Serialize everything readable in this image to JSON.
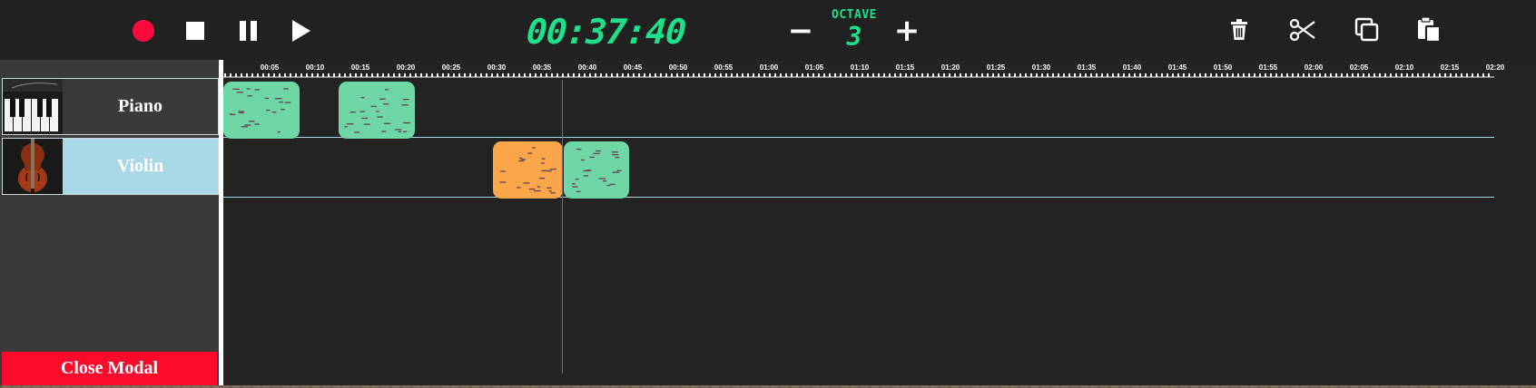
{
  "toolbar": {
    "record_icon": "record-icon",
    "stop_icon": "stop-icon",
    "pause_icon": "pause-icon",
    "play_icon": "play-icon",
    "time": "00:37:40",
    "octave_label": "OCTAVE",
    "octave_value": "3",
    "minus": "−",
    "plus": "+",
    "actions": [
      "trash-icon",
      "scissors-icon",
      "copy-icon",
      "paste-icon"
    ]
  },
  "sidebar": {
    "tracks": [
      {
        "name": "Piano",
        "icon": "piano-thumbnail"
      },
      {
        "name": "Violin",
        "icon": "violin-thumbnail"
      }
    ],
    "close_label": "Close Modal"
  },
  "timeline": {
    "ruler_labels": [
      "00:05",
      "00:10",
      "00:15",
      "00:20",
      "00:25",
      "00:30",
      "00:35",
      "00:40",
      "00:45",
      "00:50",
      "00:55",
      "01:00",
      "01:05",
      "01:10",
      "01:15",
      "01:20",
      "01:25",
      "01:30",
      "01:35",
      "01:40",
      "01:45",
      "01:50",
      "01:55",
      "02:00",
      "02:05",
      "02:10",
      "02:15",
      "02:20"
    ],
    "clips": [
      {
        "track": "Piano",
        "color": "#6fd6a5"
      },
      {
        "track": "Piano",
        "color": "#6fd6a5"
      },
      {
        "track": "Violin",
        "color": "#fca64a"
      },
      {
        "track": "Violin",
        "color": "#6fd6a5"
      }
    ]
  },
  "colors": {
    "accent": "#1fe08a",
    "record": "#ff0a3c",
    "close": "#ff0a2c",
    "selected_track": "#a9d9e6",
    "clip_green": "#6fd6a5",
    "clip_orange": "#fca64a"
  }
}
